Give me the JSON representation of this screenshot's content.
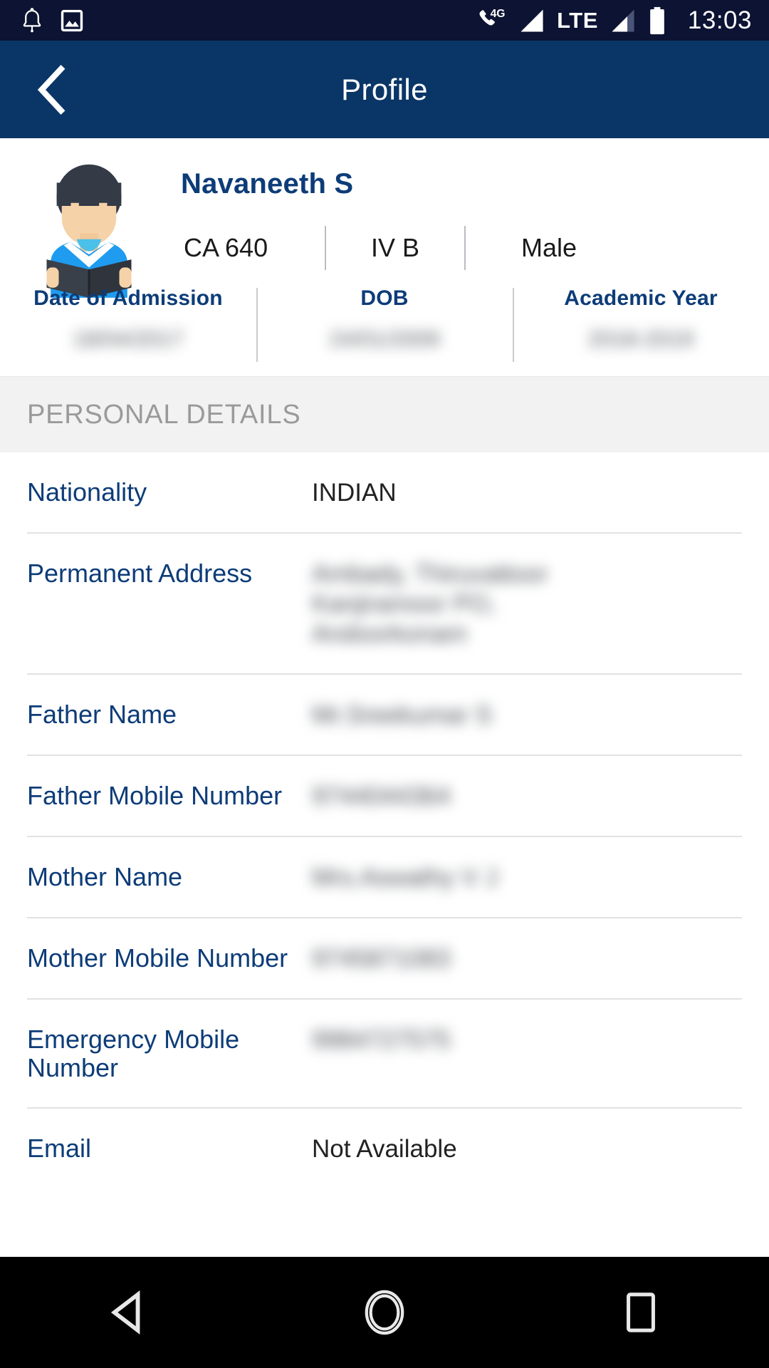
{
  "status_bar": {
    "icons": [
      "bell-icon",
      "image-icon",
      "call-4g-icon",
      "signal-bars-icon",
      "lte-label",
      "signal-bars-2-icon",
      "battery-icon"
    ],
    "network_label": "4G",
    "network_type": "LTE",
    "clock": "13:03"
  },
  "app_bar": {
    "back_icon": "chevron-left-icon",
    "title": "Profile",
    "background_color": "#0a3567"
  },
  "profile": {
    "avatar_icon": "student-reading-book-avatar",
    "name": "Navaneeth S",
    "meta": [
      {
        "label": "CA 640"
      },
      {
        "label": "IV B"
      },
      {
        "label": "Male"
      }
    ],
    "stats": [
      {
        "label": "Date of Admission",
        "value": "18/04/2017",
        "redacted": true
      },
      {
        "label": "DOB",
        "value": "24/01/2009",
        "redacted": true
      },
      {
        "label": "Academic Year",
        "value": "2018-2019",
        "redacted": true
      }
    ]
  },
  "section": {
    "title": "PERSONAL DETAILS"
  },
  "details": [
    {
      "label": "Nationality",
      "value_lines": [
        "INDIAN"
      ],
      "redacted": false
    },
    {
      "label": "Permanent Address",
      "value_lines": [
        "Ambady, Thiruvattoor",
        "Kanjiramoor PO,",
        "Andoorkonam"
      ],
      "redacted": true
    },
    {
      "label": "Father Name",
      "value_lines": [
        "Mr.Sreekumar S"
      ],
      "redacted": true
    },
    {
      "label": "Father Mobile Number",
      "value_lines": [
        "9744044364"
      ],
      "redacted": true
    },
    {
      "label": "Mother Name",
      "value_lines": [
        "Mrs.Aswathy V J"
      ],
      "redacted": true
    },
    {
      "label": "Mother Mobile Number",
      "value_lines": [
        "9745871083"
      ],
      "redacted": true
    },
    {
      "label": "Emergency Mobile Number",
      "value_lines": [
        "9984727575"
      ],
      "redacted": true
    },
    {
      "label": "Email",
      "value_lines": [
        "Not Available"
      ],
      "redacted": false
    }
  ],
  "nav_bar": {
    "back_icon": "triangle-back-icon",
    "home_icon": "circle-home-icon",
    "recents_icon": "square-recents-icon"
  },
  "colors": {
    "accent_navy": "#0d3c78",
    "appbar": "#0a3567",
    "statusbar": "#0c1333",
    "section_bg": "#f2f2f2"
  }
}
